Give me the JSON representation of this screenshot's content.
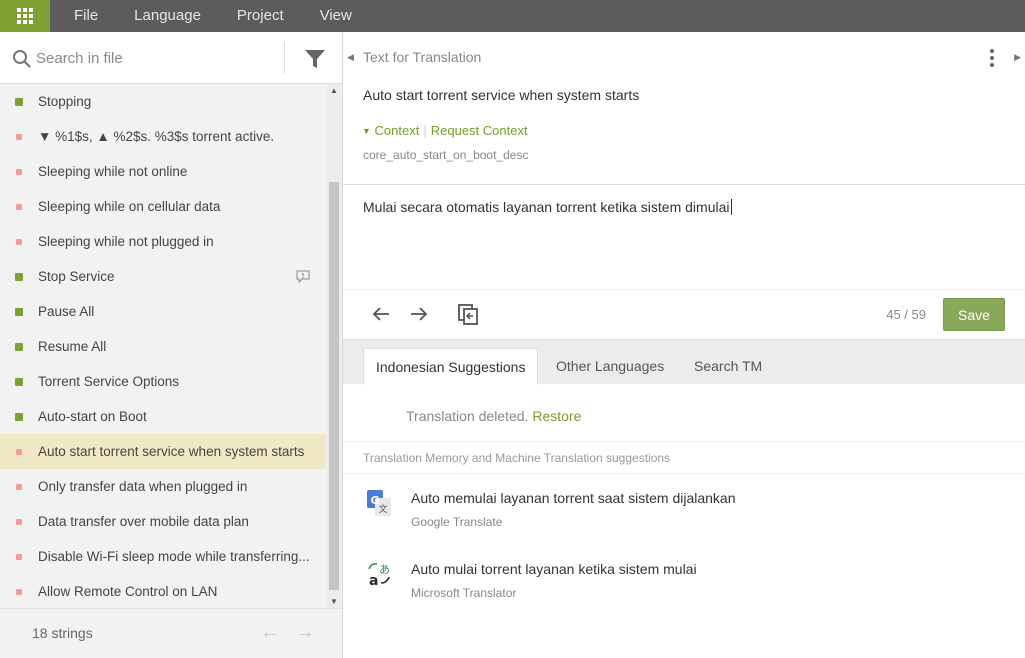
{
  "menu": {
    "items": [
      "File",
      "Language",
      "Project",
      "View"
    ]
  },
  "search": {
    "placeholder": "Search in file"
  },
  "strings": [
    {
      "label": "Stopping",
      "status": "translated"
    },
    {
      "label": "▼ %1$s, ▲ %2$s. %3$s torrent active.",
      "status": "untranslated"
    },
    {
      "label": "Sleeping while not online",
      "status": "untranslated"
    },
    {
      "label": "Sleeping while on cellular data",
      "status": "untranslated"
    },
    {
      "label": "Sleeping while not plugged in",
      "status": "untranslated"
    },
    {
      "label": "Stop Service",
      "status": "translated",
      "has_comment": true
    },
    {
      "label": "Pause All",
      "status": "translated"
    },
    {
      "label": "Resume All",
      "status": "translated"
    },
    {
      "label": "Torrent Service Options",
      "status": "translated"
    },
    {
      "label": "Auto-start on Boot",
      "status": "translated"
    },
    {
      "label": "Auto start torrent service when system starts",
      "status": "untranslated",
      "active": true
    },
    {
      "label": "Only transfer data when plugged in",
      "status": "untranslated"
    },
    {
      "label": "Data transfer over mobile data plan",
      "status": "untranslated"
    },
    {
      "label": "Disable Wi-Fi sleep mode while transferring...",
      "status": "untranslated"
    },
    {
      "label": "Allow Remote Control on LAN",
      "status": "untranslated"
    }
  ],
  "footer": {
    "count": "18 strings"
  },
  "source": {
    "header": "Text for Translation",
    "text": "Auto start torrent service when system starts",
    "context_toggle": "Context",
    "request_context": "Request Context",
    "key": "core_auto_start_on_boot_desc"
  },
  "editor": {
    "text": "Mulai secara otomatis layanan torrent ketika sistem dimulai",
    "char_count": "45 / 59",
    "save_label": "Save"
  },
  "tabs": [
    "Indonesian Suggestions",
    "Other Languages",
    "Search TM"
  ],
  "deleted": {
    "message": "Translation deleted.",
    "restore": "Restore"
  },
  "tm_header": "Translation Memory and Machine Translation suggestions",
  "suggestions": [
    {
      "text": "Auto memulai layanan torrent saat sistem dijalankan",
      "source": "Google Translate",
      "icon": "google-translate-icon"
    },
    {
      "text": "Auto mulai torrent layanan ketika sistem mulai",
      "source": "Microsoft Translator",
      "icon": "microsoft-translator-icon"
    }
  ],
  "colors": {
    "accent": "#7fa032",
    "untranslated": "#f49a9a",
    "active_row": "#f1e8c6",
    "save": "#88a85a"
  }
}
